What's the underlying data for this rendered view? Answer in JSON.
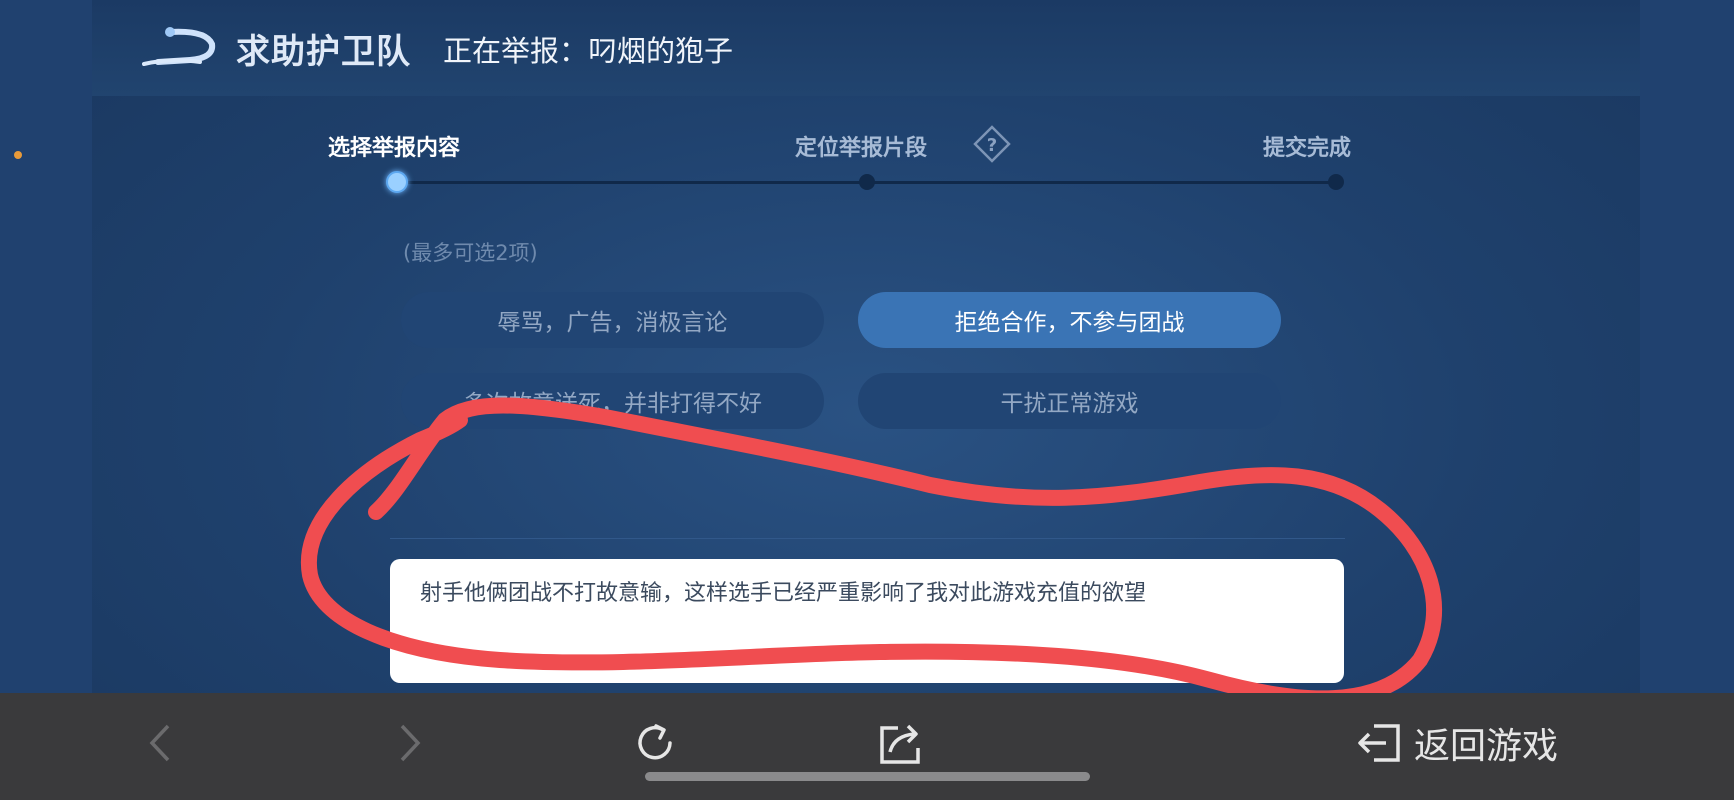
{
  "header": {
    "title": "求助护卫队",
    "subtitle": "正在举报：叼烟的狍子"
  },
  "steps": {
    "items": [
      {
        "label": "选择举报内容",
        "state": "current"
      },
      {
        "label": "定位举报片段",
        "state": "pending"
      },
      {
        "label": "提交完成",
        "state": "pending"
      }
    ],
    "help_icon": "question-diamond-icon"
  },
  "options": {
    "hint": "(最多可选2项)",
    "items": [
      {
        "label": "辱骂，广告，消极言论",
        "selected": false
      },
      {
        "label": "拒绝合作，不参与团战",
        "selected": true
      },
      {
        "label": "多次故意送死，并非打得不好",
        "selected": false
      },
      {
        "label": "干扰正常游戏",
        "selected": false
      }
    ]
  },
  "description": {
    "value": "射手他俩团战不打故意输，这样选手已经严重影响了我对此游戏充值的欲望"
  },
  "browser_bar": {
    "back_icon": "chevron-left-icon",
    "forward_icon": "chevron-right-icon",
    "reload_icon": "reload-icon",
    "share_icon": "share-icon",
    "return_label": "返回游戏",
    "return_icon": "exit-arrow-icon"
  },
  "colors": {
    "accent": "#3a74b5",
    "annotation": "#f04d50",
    "background": "#24466f",
    "bottom_bar": "#3a3a3c"
  }
}
